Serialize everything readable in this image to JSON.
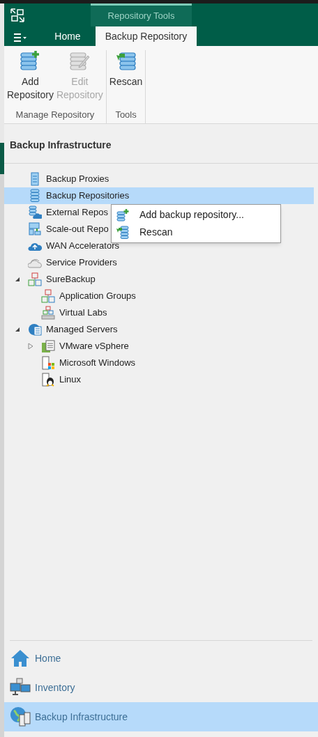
{
  "ribbon": {
    "context_title": "Repository Tools",
    "tabs": [
      {
        "label": "Home",
        "selected": false
      },
      {
        "label": "Backup Repository",
        "selected": true
      }
    ],
    "groups": [
      {
        "label": "Manage Repository",
        "buttons": [
          {
            "kind": "add",
            "lines": [
              "Add",
              "Repository"
            ],
            "disabled": false
          },
          {
            "kind": "edit",
            "lines": [
              "Edit",
              "Repository"
            ],
            "disabled": true
          }
        ]
      },
      {
        "label": "Tools",
        "buttons": [
          {
            "kind": "rescan",
            "lines": [
              "Rescan"
            ],
            "disabled": false
          }
        ]
      }
    ]
  },
  "panel": {
    "title": "Backup Infrastructure",
    "tree": [
      {
        "kind": "proxy",
        "label": "Backup Proxies",
        "selected": false
      },
      {
        "kind": "repo",
        "label": "Backup Repositories",
        "selected": true
      },
      {
        "kind": "external",
        "label": "External Repos",
        "selected": false
      },
      {
        "kind": "scaleout",
        "label": "Scale-out Repo",
        "selected": false
      },
      {
        "kind": "wan",
        "label": "WAN Accelerators",
        "selected": false
      },
      {
        "kind": "provider",
        "label": "Service Providers",
        "selected": false
      },
      {
        "kind": "sure",
        "label": "SureBackup",
        "selected": false,
        "expanded": true,
        "children": [
          {
            "kind": "sure",
            "label": "Application Groups",
            "selected": false
          },
          {
            "kind": "lab",
            "label": "Virtual Labs",
            "selected": false
          }
        ]
      },
      {
        "kind": "managed",
        "label": "Managed Servers",
        "selected": false,
        "expanded": true,
        "children": [
          {
            "kind": "vmware",
            "label": "VMware vSphere",
            "selected": false,
            "expanded": false
          },
          {
            "kind": "windows",
            "label": "Microsoft Windows",
            "selected": false
          },
          {
            "kind": "linux",
            "label": "Linux",
            "selected": false
          }
        ]
      }
    ]
  },
  "context_menu": [
    {
      "kind": "add",
      "label": "Add backup repository..."
    },
    {
      "kind": "rescan",
      "label": "Rescan"
    }
  ],
  "navigation": [
    {
      "kind": "home",
      "label": "Home",
      "selected": false
    },
    {
      "kind": "inventory",
      "label": "Inventory",
      "selected": false
    },
    {
      "kind": "infra",
      "label": "Backup Infrastructure",
      "selected": true
    }
  ]
}
